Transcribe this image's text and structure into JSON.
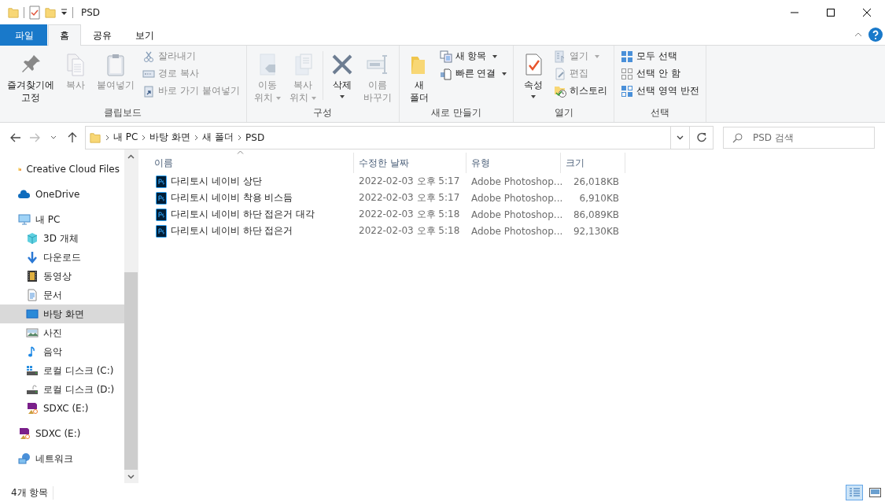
{
  "window": {
    "title": "PSD"
  },
  "ribbon_tabs": [
    {
      "label": "파일",
      "kind": "file",
      "selected": false
    },
    {
      "label": "홈",
      "kind": "tab",
      "selected": true
    },
    {
      "label": "공유",
      "kind": "tab",
      "selected": false
    },
    {
      "label": "보기",
      "kind": "tab",
      "selected": false
    }
  ],
  "ribbon_groups": [
    {
      "label": "클립보드",
      "buttons": [
        {
          "kind": "large",
          "label": "즐겨찾기에\n고정",
          "disabled": false,
          "dropdown": false
        },
        {
          "kind": "large",
          "label": "복사",
          "disabled": true,
          "dropdown": false
        },
        {
          "kind": "large",
          "label": "붙여넣기",
          "disabled": true,
          "dropdown": false
        },
        {
          "kind": "small",
          "label": "잘라내기",
          "disabled": true,
          "dropdown": false
        },
        {
          "kind": "small",
          "label": "경로 복사",
          "disabled": true,
          "dropdown": false
        },
        {
          "kind": "small",
          "label": "바로 가기 붙여넣기",
          "disabled": true,
          "dropdown": false
        }
      ]
    },
    {
      "label": "구성",
      "buttons": [
        {
          "kind": "large",
          "label": "이동\n위치",
          "disabled": true,
          "dropdown": true
        },
        {
          "kind": "large",
          "label": "복사\n위치",
          "disabled": true,
          "dropdown": true
        },
        {
          "kind": "large",
          "label": "삭제",
          "disabled": false,
          "dropdown": true
        },
        {
          "kind": "large",
          "label": "이름\n바꾸기",
          "disabled": true,
          "dropdown": false
        }
      ]
    },
    {
      "label": "새로 만들기",
      "buttons": [
        {
          "kind": "large",
          "label": "새\n폴더",
          "disabled": false,
          "dropdown": false
        },
        {
          "kind": "small",
          "label": "새 항목",
          "disabled": false,
          "dropdown": true
        },
        {
          "kind": "small",
          "label": "빠른 연결",
          "disabled": false,
          "dropdown": true
        }
      ]
    },
    {
      "label": "열기",
      "buttons": [
        {
          "kind": "large",
          "label": "속성",
          "disabled": false,
          "dropdown": true
        },
        {
          "kind": "small",
          "label": "열기",
          "disabled": true,
          "dropdown": true
        },
        {
          "kind": "small",
          "label": "편집",
          "disabled": true,
          "dropdown": false
        },
        {
          "kind": "small",
          "label": "히스토리",
          "disabled": false,
          "dropdown": false
        }
      ]
    },
    {
      "label": "선택",
      "buttons": [
        {
          "kind": "small",
          "label": "모두 선택",
          "disabled": false,
          "dropdown": false
        },
        {
          "kind": "small",
          "label": "선택 안 함",
          "disabled": false,
          "dropdown": false
        },
        {
          "kind": "small",
          "label": "선택 영역 반전",
          "disabled": false,
          "dropdown": false
        }
      ]
    }
  ],
  "address": {
    "crumbs": [
      "내 PC",
      "바탕 화면",
      "새 폴더",
      "PSD"
    ]
  },
  "search": {
    "placeholder": "PSD 검색"
  },
  "nav": {
    "items": [
      {
        "label": "Creative Cloud Files",
        "selected": false
      },
      {
        "label": "OneDrive",
        "selected": false
      },
      {
        "label": "내 PC",
        "selected": false,
        "children": [
          {
            "label": "3D 개체",
            "selected": false
          },
          {
            "label": "다운로드",
            "selected": false
          },
          {
            "label": "동영상",
            "selected": false
          },
          {
            "label": "문서",
            "selected": false
          },
          {
            "label": "바탕 화면",
            "selected": true
          },
          {
            "label": "사진",
            "selected": false
          },
          {
            "label": "음악",
            "selected": false
          },
          {
            "label": "로컬 디스크 (C:)",
            "selected": false
          },
          {
            "label": "로컬 디스크 (D:)",
            "selected": false
          },
          {
            "label": "SDXC (E:)",
            "selected": false
          }
        ]
      },
      {
        "label": "SDXC (E:)",
        "selected": false
      },
      {
        "label": "네트워크",
        "selected": false
      }
    ]
  },
  "file_list": {
    "columns": [
      "이름",
      "수정한 날짜",
      "유형",
      "크기"
    ],
    "rows": [
      {
        "name": "다리토시 네이비 상단",
        "modified": "2022-02-03 오후 5:17",
        "type": "Adobe Photoshop...",
        "size": "26,018KB"
      },
      {
        "name": "다리토시 네이비 착용 비스듬",
        "modified": "2022-02-03 오후 5:17",
        "type": "Adobe Photoshop...",
        "size": "6,910KB"
      },
      {
        "name": "다리토시 네이비 하단 접은거 대각",
        "modified": "2022-02-03 오후 5:18",
        "type": "Adobe Photoshop...",
        "size": "86,089KB"
      },
      {
        "name": "다리토시 네이비 하단 접은거",
        "modified": "2022-02-03 오후 5:18",
        "type": "Adobe Photoshop...",
        "size": "92,130KB"
      }
    ]
  },
  "status_bar": {
    "item_count": "4개 항목",
    "view_buttons": [
      {
        "selected": true
      },
      {
        "selected": false
      }
    ]
  }
}
